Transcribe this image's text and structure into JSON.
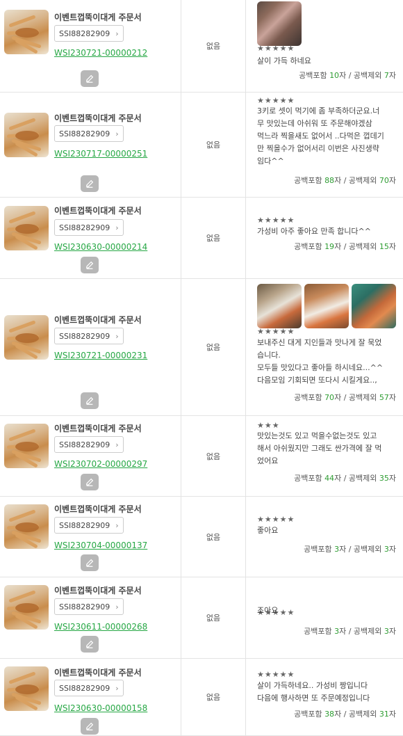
{
  "rows": [
    {
      "product": "이벤트껍뚝이대게 주문서",
      "sku": "SSI88282909",
      "order": "WSI230721-00000212",
      "option": "없음",
      "stars": "★★★★★",
      "text": "살이 가득 하네요",
      "label_incl": "공백포함",
      "incl": "10",
      "incl_unit": "자",
      "label_excl": "/ 공백제외",
      "excl": "7",
      "excl_unit": "자",
      "photos": [
        "photo-crab-legs"
      ]
    },
    {
      "product": "이벤트껍뚝이대게 주문서",
      "sku": "SSI88282909",
      "order": "WSI230717-00000251",
      "option": "없음",
      "stars": "★★★★★",
      "text": "3키로 셋이 먹기에 좀 부족하더군요.너\n무 맛있는데 아쉬워 또 주문해야겠삼\n먹느라 찍을새도 없어서 ..다먹은 껍데기\n만 찍을수가 없어서리 이번은 사진생략\n임다^^",
      "label_incl": "공백포함",
      "incl": "88",
      "incl_unit": "자",
      "label_excl": "/ 공백제외",
      "excl": "70",
      "excl_unit": "자",
      "photos": []
    },
    {
      "product": "이벤트껍뚝이대게 주문서",
      "sku": "SSI88282909",
      "order": "WSI230630-00000214",
      "option": "없음",
      "stars": "★★★★★",
      "text": "가성비 아주 좋아요 만족 합니다^^",
      "label_incl": "공백포함",
      "incl": "19",
      "incl_unit": "자",
      "label_excl": "/ 공백제외",
      "excl": "15",
      "excl_unit": "자",
      "photos": []
    },
    {
      "product": "이벤트껍뚝이대게 주문서",
      "sku": "SSI88282909",
      "order": "WSI230721-00000231",
      "option": "없음",
      "stars": "★★★★★",
      "text": "보내주신 대게 지인들과 맛나게 잘 묵었\n습니다.\n모두들 맛있다고 좋아들 하시네요...^^\n다음모임 기회되면 또다시 시킬게요..,",
      "label_incl": "공백포함",
      "incl": "70",
      "incl_unit": "자",
      "label_excl": "/ 공백제외",
      "excl": "57",
      "excl_unit": "자",
      "photos": [
        "photo-crab-plate-1",
        "photo-crab-plate-2",
        "photo-crab-plate-3"
      ]
    },
    {
      "product": "이벤트껍뚝이대게 주문서",
      "sku": "SSI88282909",
      "order": "WSI230702-00000297",
      "option": "없음",
      "stars": "★★★",
      "text": "맛있는것도 있고 먹을수없는것도 있고\n해서 아쉬웠지만 그래도 싼가격에 잘 먹\n었어요",
      "label_incl": "공백포함",
      "incl": "44",
      "incl_unit": "자",
      "label_excl": "/ 공백제외",
      "excl": "35",
      "excl_unit": "자",
      "photos": []
    },
    {
      "product": "이벤트껍뚝이대게 주문서",
      "sku": "SSI88282909",
      "order": "WSI230704-00000137",
      "option": "없음",
      "stars": "★★★★★",
      "text": "좋아요",
      "label_incl": "공백포함",
      "incl": "3",
      "incl_unit": "자",
      "label_excl": "/ 공백제외",
      "excl": "3",
      "excl_unit": "자",
      "photos": []
    },
    {
      "product": "이벤트껍뚝이대게 주문서",
      "sku": "SSI88282909",
      "order": "WSI230611-00000268",
      "option": "없음",
      "stars": "★★★★★",
      "text": "조아요",
      "label_incl": "공백포함",
      "incl": "3",
      "incl_unit": "자",
      "label_excl": "/ 공백제외",
      "excl": "3",
      "excl_unit": "자",
      "photos": []
    },
    {
      "product": "이벤트껍뚝이대게 주문서",
      "sku": "SSI88282909",
      "order": "WSI230630-00000158",
      "option": "없음",
      "stars": "★★★★★",
      "text": "살이 가득하네요.. 가성비 짱입니다\n다음에 행사하면 또 주문예정입니다",
      "label_incl": "공백포함",
      "incl": "38",
      "incl_unit": "자",
      "label_excl": "/ 공백제외",
      "excl": "31",
      "excl_unit": "자",
      "photos": []
    }
  ],
  "icons": {
    "thumb": "crab-thumbnail",
    "chevron": "chevron-right-icon",
    "edit": "pencil-icon"
  },
  "colors": {
    "order_link": "#26a744",
    "count_number": "#2e9c32",
    "border": "#e3e3e3",
    "edit_button": "#b7b7b7"
  }
}
